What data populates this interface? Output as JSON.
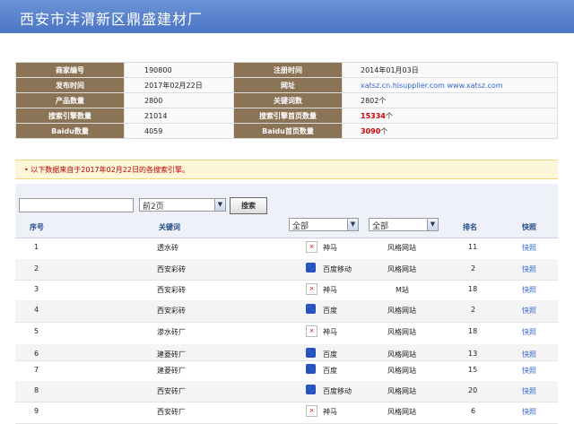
{
  "header": {
    "title": "西安市沣渭新区鼎盛建材厂"
  },
  "info": {
    "rows": [
      {
        "k1": "商家编号",
        "v1": "190800",
        "k2": "注册时间",
        "v2": "2014年01月03日"
      },
      {
        "k1": "发布时间",
        "v1": "2017年02月22日",
        "k2": "网址",
        "v2": "xatsz.cn.hisupplier.com www.xatsz.com"
      },
      {
        "k1": "产品数量",
        "v1": "2800",
        "k2": "关键词数",
        "v2": "2802个"
      },
      {
        "k1": "搜索引擎数量",
        "v1": "21014",
        "k2": "搜索引擎首页数量",
        "v2_num": "15334",
        "v2_unit": "个"
      },
      {
        "k1": "Baidu数量",
        "v1": "4059",
        "k2": "Baidu首页数量",
        "v2_num": "3090",
        "v2_unit": "个"
      }
    ]
  },
  "notice": "• 以下数据来自于2017年02月22日的各搜索引擎。",
  "toolbar": {
    "search_value": "",
    "page_select": "前2页",
    "search_button": "搜索"
  },
  "grid": {
    "headers": {
      "no": "序号",
      "keyword": "关键词",
      "rank": "排名",
      "snapshot": "快照"
    },
    "type_select": "全部",
    "site_select": "全部",
    "rows": [
      {
        "no": "1",
        "keyword": "透水砖",
        "engine": "神马",
        "icon": "shenma",
        "site": "风格网站",
        "rank": "11",
        "snap": "快照"
      },
      {
        "no": "2",
        "keyword": "西安彩砖",
        "engine": "百度移动",
        "icon": "baidu",
        "site": "风格网站",
        "rank": "2",
        "snap": "快照"
      },
      {
        "no": "3",
        "keyword": "西安彩砖",
        "engine": "神马",
        "icon": "shenma",
        "site": "M站",
        "rank": "18",
        "snap": "快照"
      },
      {
        "no": "4",
        "keyword": "西安彩砖",
        "engine": "百度",
        "icon": "baidu",
        "site": "风格网站",
        "rank": "2",
        "snap": "快照"
      },
      {
        "no": "5",
        "keyword": "渗水砖厂",
        "engine": "神马",
        "icon": "shenma",
        "site": "风格网站",
        "rank": "18",
        "snap": "快照"
      },
      {
        "no": "6",
        "keyword": "建菱砖厂",
        "engine": "百度",
        "icon": "baidu",
        "site": "风格网站",
        "rank": "13",
        "snap": "快照"
      },
      {
        "no": "7",
        "keyword": "建菱砖厂",
        "engine": "百度",
        "icon": "baidu",
        "site": "风格网站",
        "rank": "15",
        "snap": "快照"
      },
      {
        "no": "8",
        "keyword": "西安砖厂",
        "engine": "百度移动",
        "icon": "baidu",
        "site": "风格网站",
        "rank": "20",
        "snap": "快照"
      },
      {
        "no": "9",
        "keyword": "西安砖厂",
        "engine": "神马",
        "icon": "shenma",
        "site": "风格网站",
        "rank": "6",
        "snap": "快照"
      }
    ]
  },
  "colors": {
    "header": "#4a75c4",
    "label_bg": "#8b7356",
    "link": "#3366cc",
    "highlight": "#d00000"
  }
}
